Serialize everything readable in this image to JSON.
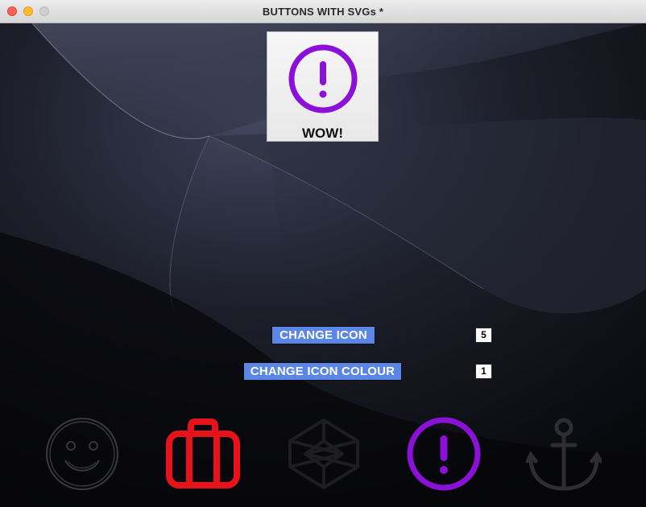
{
  "window": {
    "title": "BUTTONS WITH SVGs *"
  },
  "preview": {
    "label": "WOW!",
    "icon": "exclamation-circle-icon",
    "color": "#8b10d8"
  },
  "controls": {
    "change_icon_label": "CHANGE ICON",
    "change_icon_value": "5",
    "change_colour_label": "CHANGE ICON COLOUR",
    "change_colour_value": "1"
  },
  "icons": [
    {
      "name": "smiley-icon",
      "color": "#3a3a3e"
    },
    {
      "name": "briefcase-icon",
      "color": "#e8131a"
    },
    {
      "name": "codepen-icon",
      "color": "#1e1e22"
    },
    {
      "name": "exclamation-circle-icon",
      "color": "#8b10d8"
    },
    {
      "name": "anchor-icon",
      "color": "#2e2e32"
    }
  ],
  "colors": {
    "button": "#5a86e8",
    "accent": "#8b10d8"
  }
}
